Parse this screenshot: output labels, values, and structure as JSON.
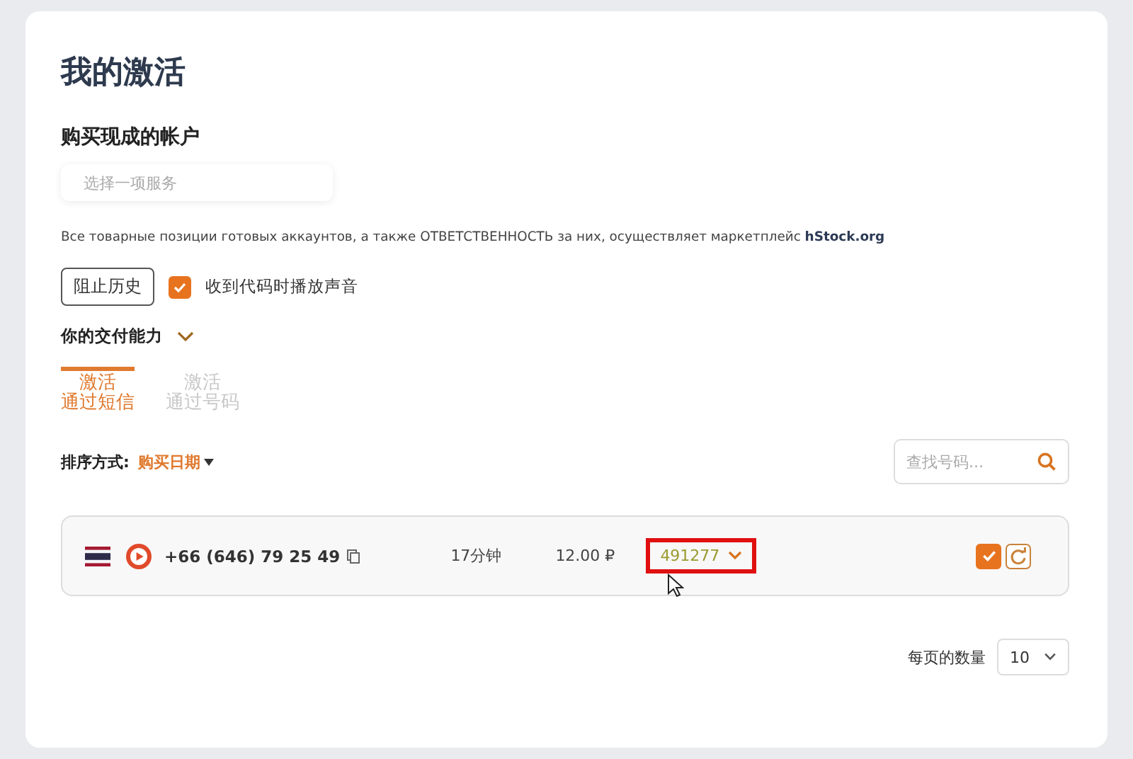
{
  "title": "我的激活",
  "buy_section": {
    "heading": "购买现成的帐户",
    "service_select": {
      "placeholder": "选择一项服务"
    }
  },
  "notice": {
    "text": "Все товарные позиции готовых аккаунтов, а также ОТВЕТСТВЕННОСТЬ за них, осуществляет маркетплейс",
    "link": "hStock.org"
  },
  "history_button": "阻止历史",
  "sound_option": {
    "label": "收到代码时播放声音",
    "checked": true
  },
  "delivery": {
    "label": "你的交付能力",
    "expanded": false
  },
  "tabs": [
    {
      "line1": "激活",
      "line2": "通过短信",
      "selected": true
    },
    {
      "line1": "激活",
      "line2": "通过号码",
      "selected": false
    }
  ],
  "sort": {
    "label": "排序方式:",
    "value": "购买日期"
  },
  "search": {
    "placeholder": "查找号码..."
  },
  "activations": [
    {
      "phone": "+66 (646) 79 25 49",
      "time": "17分钟",
      "price": "12.00 ₽",
      "code": "491277",
      "highlighted": true,
      "done": true
    }
  ],
  "pagination": {
    "label": "每页的数量",
    "value": "10"
  }
}
